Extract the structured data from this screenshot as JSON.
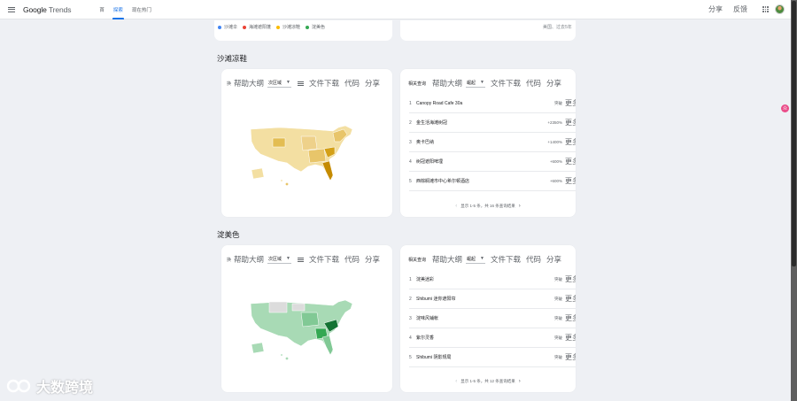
{
  "app": {
    "logo": "Google",
    "product": "Trends"
  },
  "nav": {
    "items": [
      "首",
      "探索",
      "现在热门"
    ],
    "active_index": 1
  },
  "top_actions": {
    "share": "分享",
    "feedback": "反馈"
  },
  "legend": {
    "items": [
      {
        "label": "沙滩伞",
        "color": "#4285f4"
      },
      {
        "label": "海滩遮阳蓬",
        "color": "#ea4335"
      },
      {
        "label": "沙滩凉鞋",
        "color": "#fbbc04"
      },
      {
        "label": "淀美色",
        "color": "#34a853"
      }
    ],
    "region_note": "美国、过去5年"
  },
  "sections": [
    {
      "title": "沙滩凉鞋",
      "map_card": {
        "icon_text": "换",
        "help": "帮助大纲",
        "select_value": "次区域",
        "download": "文件下载",
        "code": "代码",
        "share": "分享"
      },
      "query_card": {
        "title": "相关查询",
        "help": "帮助大纲",
        "select_value": "崛起",
        "download": "文件下载",
        "code": "代码",
        "share": "分享",
        "rows": [
          {
            "index": "1",
            "term": "Canopy Road Cafe 30a",
            "value": "突破",
            "more": "更多"
          },
          {
            "index": "2",
            "term": "金生活海滩树冠",
            "value": "+2350%",
            "more": "更多"
          },
          {
            "index": "3",
            "term": "奥卡巴纳",
            "value": "+1400%",
            "more": "更多"
          },
          {
            "index": "4",
            "term": "树冠遮阳啤埋",
            "value": "+600%",
            "more": "更多"
          },
          {
            "index": "5",
            "term": "西棕榈滩市中心希尔顿酒店",
            "value": "+600%",
            "more": "更多"
          }
        ],
        "pager": "显示 1-5 条，共 16 条查询结果"
      },
      "map_colors": {
        "base": "#f3dfa2",
        "mid": "#e8c56a",
        "dark": "#d4a017",
        "hot": "#c58b00"
      }
    },
    {
      "title": "淀美色",
      "map_card": {
        "icon_text": "换",
        "help": "帮助大纲",
        "select_value": "次区域",
        "download": "文件下载",
        "code": "代码",
        "share": "分享"
      },
      "query_card": {
        "title": "相关查询",
        "help": "帮助大纲",
        "select_value": "崛起",
        "download": "文件下载",
        "code": "代码",
        "share": "分享",
        "rows": [
          {
            "index": "1",
            "term": "淀美迷彩",
            "value": "突破",
            "more": "更多"
          },
          {
            "index": "2",
            "term": "Shibumi 迷你遮阳帘",
            "value": "突破",
            "more": "更多"
          },
          {
            "index": "3",
            "term": "淀味风铺帐",
            "value": "突破",
            "more": "更多"
          },
          {
            "index": "4",
            "term": "紫尔灵香",
            "value": "突破",
            "more": "更多"
          },
          {
            "index": "5",
            "term": "Shibumi 阴影规局",
            "value": "突破",
            "more": "更多"
          }
        ],
        "pager": "显示 1-5 条，共 12 条查询结果"
      },
      "map_colors": {
        "base": "#a8dab5",
        "mid": "#81c995",
        "dark": "#34a853",
        "hot": "#137333"
      }
    }
  ],
  "watermark": "大数跨境",
  "side_badge": "众"
}
